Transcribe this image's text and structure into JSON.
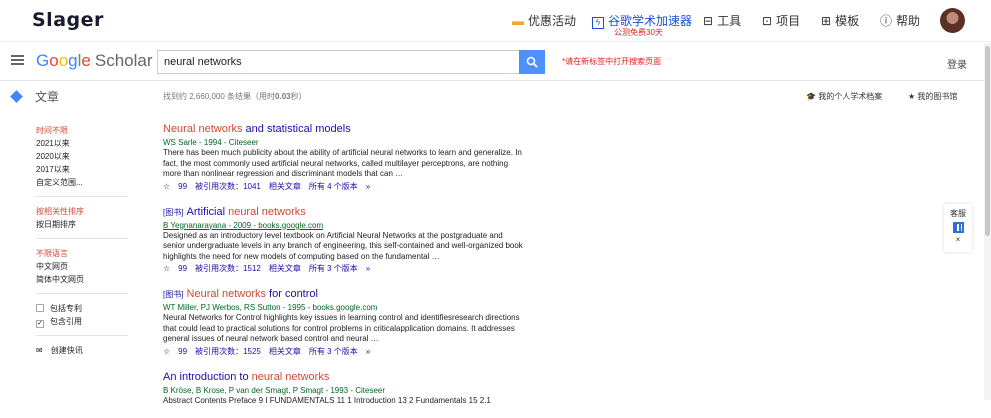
{
  "topbar": {
    "brand": "Slager",
    "nav": [
      {
        "label": "优惠活动",
        "icon": "gift-icon"
      },
      {
        "label": "谷歌学术加速器",
        "icon": "bolt-icon"
      },
      {
        "label": "工具",
        "icon": "briefcase-icon"
      },
      {
        "label": "项目",
        "icon": "document-icon"
      },
      {
        "label": "模板",
        "icon": "grid-icon"
      },
      {
        "label": "帮助",
        "icon": "help-icon"
      }
    ],
    "speed_sub": "公测免费30天"
  },
  "scholar": {
    "logo_google": [
      "G",
      "o",
      "o",
      "g",
      "l",
      "e"
    ],
    "logo_scholar": "Scholar",
    "search_value": "neural networks",
    "new_tab_note": "*请在新标签中打开搜索页面",
    "login": "登录",
    "articles_label": "文章",
    "count": "找到约 2,660,000 条结果（用时",
    "count_time": "0.03",
    "count_unit": "秒）",
    "my_profile": "我的个人学术档案",
    "my_library": "我的图书馆"
  },
  "sidebar": {
    "time_filters": [
      "时间不限",
      "2021以来",
      "2020以来",
      "2017以来",
      "自定义范围..."
    ],
    "sort": [
      "按相关性排序",
      "按日期排序"
    ],
    "lang": [
      "不限语言",
      "中文网页",
      "简体中文网页"
    ],
    "include_patents": "包括专利",
    "include_citations": "包含引用",
    "alert": "创建快讯"
  },
  "results": [
    {
      "tag": "",
      "title_pre": "",
      "title_hl": "Neural networks",
      "title_post": " and statistical models",
      "meta": "WS Sarle - 1994 - Citeseer",
      "snip": "There has been much publicity about the ability of artificial neural networks to learn and generalize. In fact, the most commonly used artificial neural networks, called multilayer perceptrons, are nothing more than nonlinear regression and discriminant models that can …",
      "cited": "被引用次数：1041",
      "related": "相关文章",
      "versions": "所有 4 个版本"
    },
    {
      "tag": "[图书]",
      "title_pre": " Artificial ",
      "title_hl": "neural networks",
      "title_post": "",
      "meta": "B Yegnanarayana - 2009 - books.google.com",
      "snip": "Designed as an introductory level textbook on Artificial Neural Networks at the postgraduate and senior undergraduate levels in any branch of engineering, this self-contained and well-organized book highlights the need for new models of computing based on the fundamental …",
      "cited": "被引用次数：1512",
      "related": "相关文章",
      "versions": "所有 3 个版本"
    },
    {
      "tag": "[图书]",
      "title_pre": " ",
      "title_hl": "Neural networks",
      "title_post": " for control",
      "meta": "WT Miller, PJ Werbos, RS Sutton - 1995 - books.google.com",
      "snip": "Neural Networks for Control highlights key issues in learning control and identifiesresearch directions that could lead to practical solutions for control problems in criticalapplication domains. It addresses general issues of neural network based control and neural …",
      "cited": "被引用次数：1525",
      "related": "相关文章",
      "versions": "所有 3 个版本"
    },
    {
      "tag": "",
      "title_pre": "An introduction to ",
      "title_hl": "neural networks",
      "title_post": "",
      "meta": "B Kröse, B Krose, P van der Smagt, P Smagt - 1993 - Citeseer",
      "snip": "Abstract Contents Preface 9 I FUNDAMENTALS 11 1 Introduction 13 2 Fundamentals 15 2.1",
      "cited": "",
      "related": "",
      "versions": ""
    }
  ],
  "float": {
    "label": "客服",
    "close": "×"
  }
}
